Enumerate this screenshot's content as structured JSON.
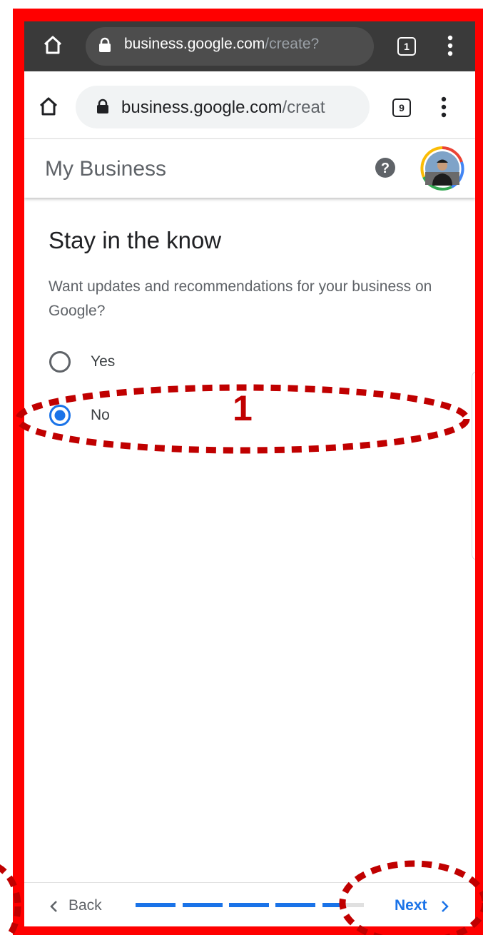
{
  "browser_outer": {
    "url_host": "business.google.com",
    "url_path": "/create?",
    "tab_count": "1"
  },
  "browser_inner": {
    "url_host": "business.google.com",
    "url_path": "/creat",
    "tab_count": "9"
  },
  "header": {
    "title": "My Business",
    "help_icon": "help-circle-icon",
    "avatar_icon": "user-avatar"
  },
  "content": {
    "title": "Stay in the know",
    "description": "Want updates and recommendations for your business on Google?",
    "options": [
      {
        "label": "Yes",
        "selected": false
      },
      {
        "label": "No",
        "selected": true
      }
    ]
  },
  "annotations": {
    "step_number": "1",
    "color": "#c00000"
  },
  "footer": {
    "back_label": "Back",
    "next_label": "Next",
    "progress": {
      "completed_segments": 5,
      "total_segments": 6
    }
  },
  "colors": {
    "accent": "#1a73e8",
    "frame": "#ff0000",
    "annotation": "#c00000"
  }
}
